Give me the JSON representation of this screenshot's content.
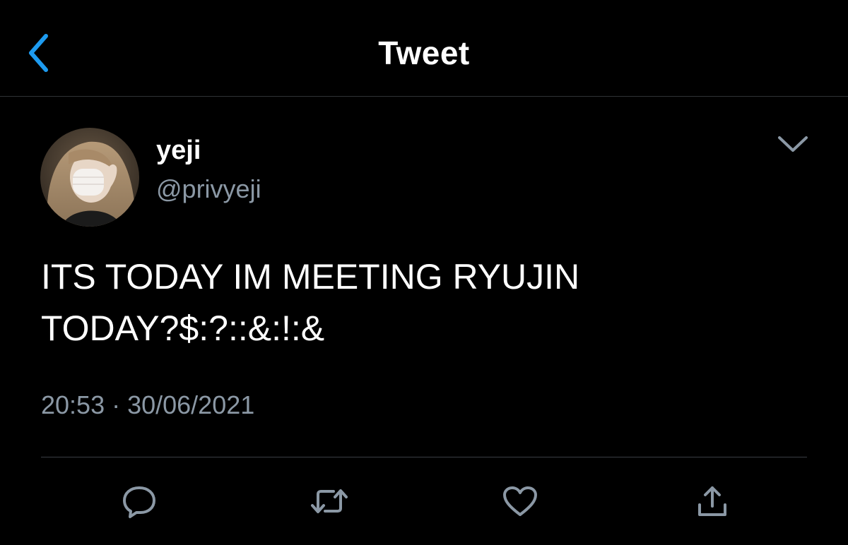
{
  "header": {
    "title": "Tweet",
    "back_icon": "chevron-left-icon",
    "accent_color": "#1d9bf0"
  },
  "tweet": {
    "author": {
      "display_name": "yeji",
      "handle": "@privyeji"
    },
    "text": "ITS TODAY IM MEETING RYUJIN\nTODAY?$:?::&:!:&",
    "time": "20:53",
    "separator": "·",
    "date": "30/06/2021"
  },
  "actions": [
    {
      "name": "reply",
      "icon": "reply-icon"
    },
    {
      "name": "retweet",
      "icon": "retweet-icon"
    },
    {
      "name": "like",
      "icon": "heart-icon"
    },
    {
      "name": "share",
      "icon": "share-icon"
    }
  ],
  "colors": {
    "background": "#000000",
    "text": "#ffffff",
    "secondary_text": "#8b98a5",
    "action_icon": "#8b98a5",
    "divider": "#3a3f44"
  }
}
